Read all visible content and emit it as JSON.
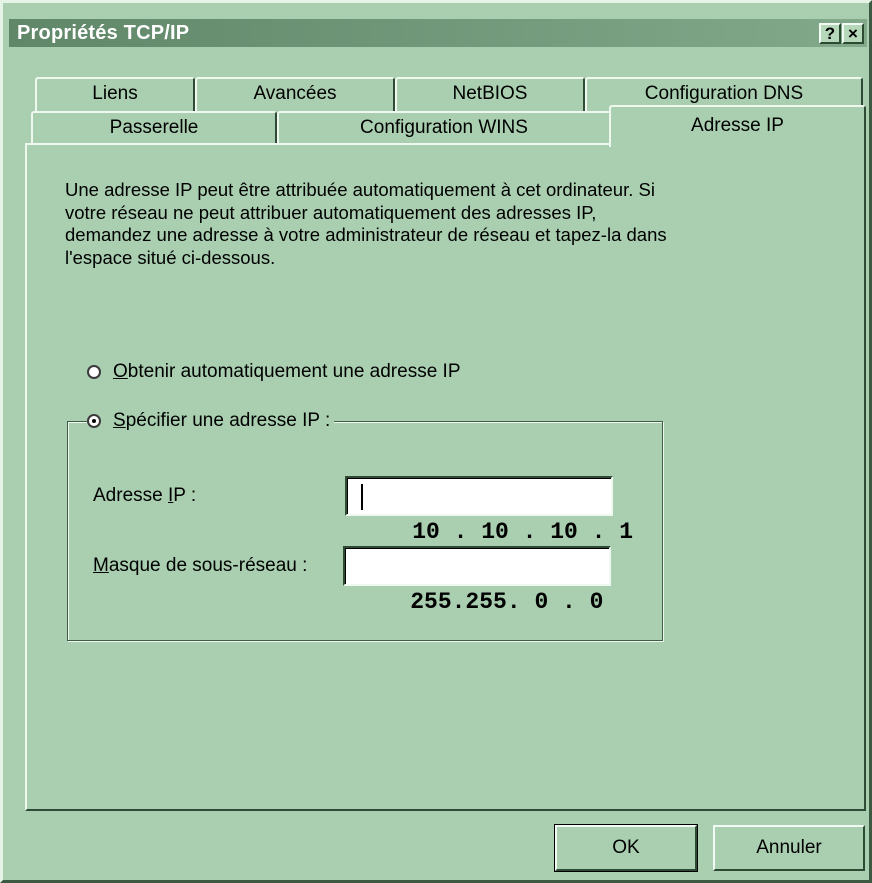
{
  "window": {
    "title": "Propriétés TCP/IP",
    "help_button": "?",
    "close_button": "×"
  },
  "tabs": {
    "row1": [
      "Liens",
      "Avancées",
      "NetBIOS",
      "Configuration DNS"
    ],
    "row2": [
      "Passerelle",
      "Configuration WINS",
      "Adresse IP"
    ],
    "active": "Adresse IP"
  },
  "description": "Une adresse IP peut être attribuée automatiquement à cet ordinateur. Si votre réseau ne peut attribuer automatiquement des adresses IP, demandez une adresse à votre administrateur de réseau et tapez-la dans l'espace situé ci-dessous.",
  "options": {
    "auto": {
      "label_rest": "btenir automatiquement une adresse IP",
      "accel": "O",
      "checked": false
    },
    "manual": {
      "label_rest": "pécifier une adresse IP :",
      "accel": "S",
      "checked": true
    }
  },
  "fields": {
    "ip": {
      "label_before": "Adresse ",
      "accel": "I",
      "label_after": "P :",
      "value": "10 . 10 . 10 . 1"
    },
    "mask": {
      "label_before": "",
      "accel": "M",
      "label_after": "asque de sous-réseau :",
      "value": "255.255. 0 . 0"
    }
  },
  "buttons": {
    "ok": "OK",
    "cancel": "Annuler"
  }
}
